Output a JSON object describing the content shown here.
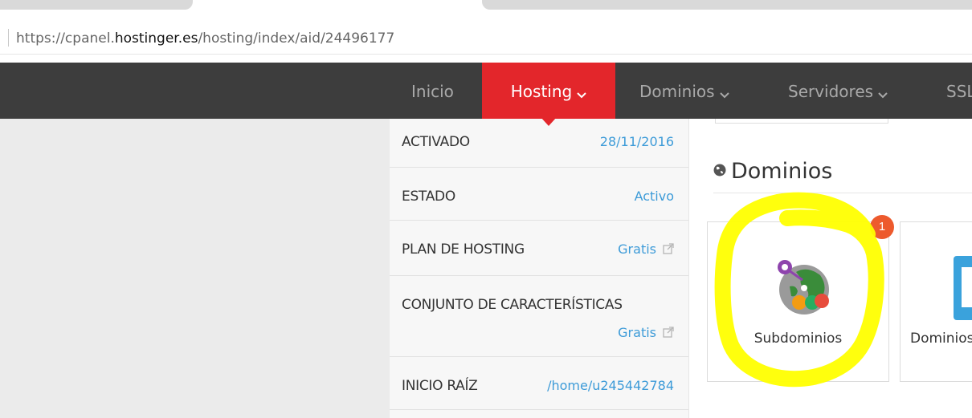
{
  "browser": {
    "url_prefix": "https://cpanel.",
    "url_host": "hostinger.es",
    "url_path": "/hosting/index/aid/24496177"
  },
  "nav": {
    "items": [
      {
        "label": "Inicio"
      },
      {
        "label": "Hosting"
      },
      {
        "label": "Dominios"
      },
      {
        "label": "Servidores"
      },
      {
        "label": "SSL"
      }
    ],
    "active": "Hosting",
    "active_color": "#e3262b"
  },
  "info": {
    "rows": [
      {
        "label": "ACTIVADO",
        "value": "28/11/2016"
      },
      {
        "label": "ESTADO",
        "value": "Activo"
      },
      {
        "label": "PLAN DE HOSTING",
        "value": "Gratis",
        "external": true
      },
      {
        "label": "CONJUNTO DE CARACTERÍSTICAS",
        "value": "Gratis",
        "external": true
      },
      {
        "label": "INICIO RAÍZ",
        "value": "/home/u245442784"
      }
    ]
  },
  "main": {
    "section_title": "Dominios",
    "section_icon": "globe-icon",
    "cards": [
      {
        "label": "Subdominios",
        "badge": "1",
        "icon": "subdomains-globe-icon"
      },
      {
        "label": "Dominios",
        "icon": "domains-icon"
      }
    ]
  },
  "colors": {
    "link": "#3d9bd8",
    "nav_bg": "#3d3d3d",
    "badge": "#ed5a2d",
    "highlight": "#ffff00"
  }
}
